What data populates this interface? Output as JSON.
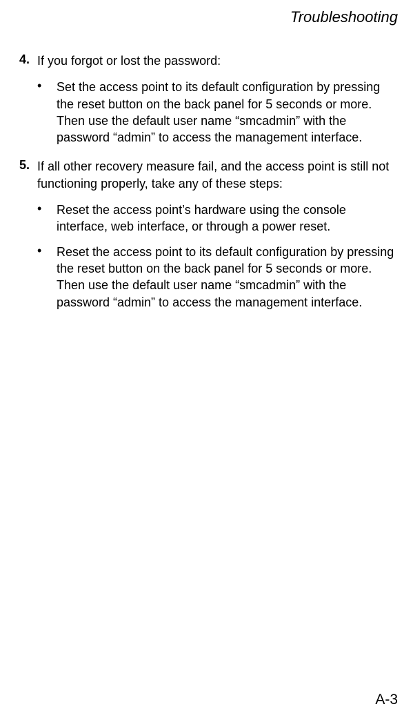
{
  "header": {
    "title": "Troubleshooting"
  },
  "items": [
    {
      "number": "4.",
      "text": "If you forgot or lost the password:",
      "bullets": [
        "Set the access point to its default configuration by pressing the reset button on the back panel for 5 seconds or more. Then use the default user name “smcadmin” with the password “admin” to access the management interface."
      ]
    },
    {
      "number": "5.",
      "text": "If all other recovery measure fail, and the access point is still not functioning properly, take any of these steps:",
      "bullets": [
        "Reset the access point’s hardware using the console interface, web interface, or through a power reset.",
        "Reset the access point to its default configuration by pressing the reset button on the back panel for 5 seconds or more. Then use the default user name “smcadmin” with the password “admin” to access the management interface."
      ]
    }
  ],
  "pageNumber": "A-3",
  "bulletChar": "•"
}
